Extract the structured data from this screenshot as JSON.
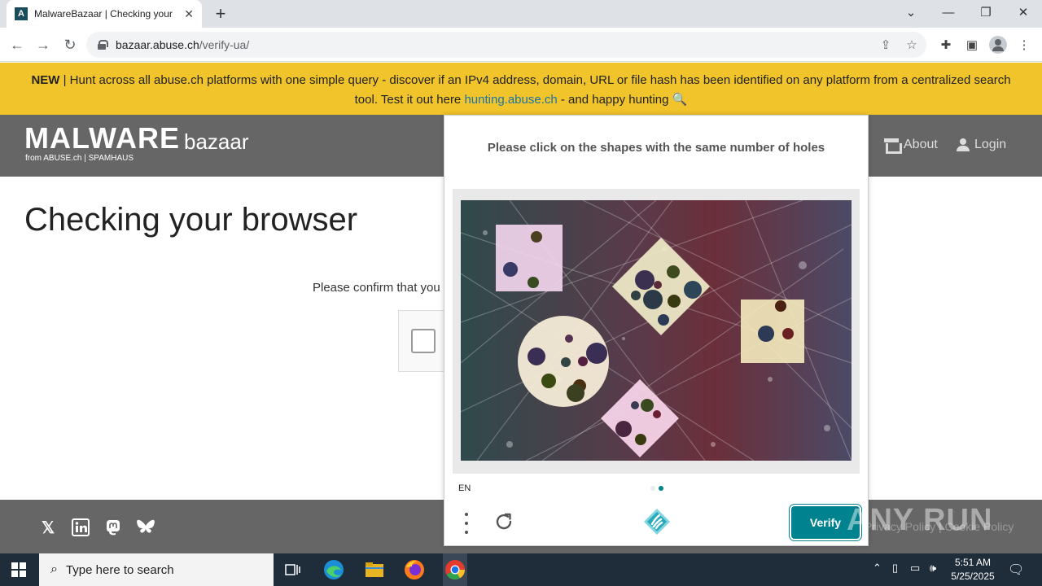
{
  "browser": {
    "tab_title": "MalwareBazaar | Checking your browser",
    "tab_favicon": "A",
    "new_tab": "+",
    "url_host": "bazaar.abuse.ch",
    "url_path": "/verify-ua/"
  },
  "banner": {
    "new_label": "NEW",
    "text_before": " | Hunt across all abuse.ch platforms with one simple query - discover if an IPv4 address, domain, URL or file hash has been identified on any platform from a centralized search tool. Test it out here ",
    "link_text": "hunting.abuse.ch",
    "text_after": " - and happy hunting 🔍"
  },
  "header": {
    "logo_main": "MALWARE",
    "logo_sub": "bazaar",
    "logo_from": "from ABUSE.ch  |  SPAMHAUS",
    "nav_about": "About",
    "nav_login": "Login"
  },
  "main": {
    "title": "Checking your browser",
    "confirm_text": "Please confirm that you are human"
  },
  "captcha": {
    "prompt": "Please click on the shapes with the same number of holes",
    "language": "EN",
    "verify_label": "Verify",
    "accent": "#00838f"
  },
  "footer": {
    "links": "Privacy Policy  |  Cookie Policy"
  },
  "watermark": "ANY RUN",
  "taskbar": {
    "search_placeholder": "Type here to search",
    "time": "5:51 AM",
    "date": "5/25/2025"
  }
}
